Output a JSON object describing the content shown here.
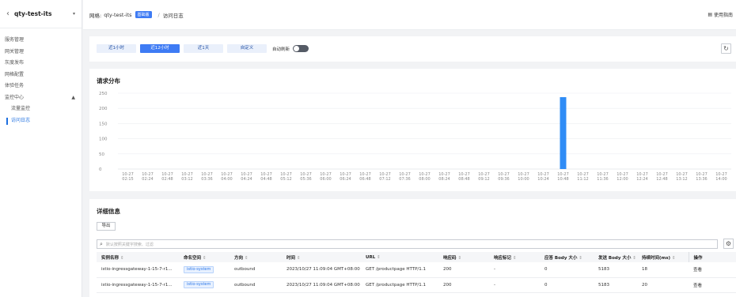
{
  "sidebar": {
    "title": "qty-test-its",
    "items": [
      {
        "label": "服务管理"
      },
      {
        "label": "网关管理"
      },
      {
        "label": "灰度发布"
      },
      {
        "label": "网格配置"
      },
      {
        "label": "体验任务"
      }
    ],
    "group": {
      "label": "监控中心",
      "sub": [
        {
          "label": "流量监控"
        },
        {
          "label": "访问日志"
        }
      ]
    }
  },
  "topbar": {
    "mesh_prefix": "网格:",
    "mesh_name": "qty-test-its",
    "edition": "基础版",
    "separator": "/",
    "page": "访问日志",
    "guide": "使用指南"
  },
  "range": {
    "tabs": [
      "近1小时",
      "近12小时",
      "近1天",
      "自定义"
    ],
    "active_index": 1,
    "auto_refresh_label": "自动刷新",
    "auto_refresh_on": false
  },
  "chart": {
    "title": "请求分布",
    "color": "#2f8cf6"
  },
  "chart_data": {
    "type": "bar",
    "title": "请求分布",
    "ylim": [
      0,
      250
    ],
    "yticks": [
      0,
      50,
      100,
      150,
      200,
      250
    ],
    "categories": [
      "10-27 02:15",
      "10-27 02:24",
      "10-27 02:48",
      "10-27 03:12",
      "10-27 03:36",
      "10-27 04:00",
      "10-27 04:24",
      "10-27 04:48",
      "10-27 05:12",
      "10-27 05:36",
      "10-27 06:00",
      "10-27 06:24",
      "10-27 06:48",
      "10-27 07:12",
      "10-27 07:36",
      "10-27 08:00",
      "10-27 08:24",
      "10-27 08:48",
      "10-27 09:12",
      "10-27 09:36",
      "10-27 10:00",
      "10-27 10:24",
      "10-27 10:48",
      "10-27 11:12",
      "10-27 11:36",
      "10-27 12:00",
      "10-27 12:24",
      "10-27 12:48",
      "10-27 13:12",
      "10-27 13:36",
      "10-27 14:00"
    ],
    "values": [
      0,
      0,
      0,
      0,
      0,
      0,
      0,
      0,
      0,
      0,
      0,
      0,
      0,
      0,
      0,
      0,
      0,
      0,
      0,
      0,
      0,
      0,
      237,
      0,
      0,
      0,
      0,
      0,
      0,
      0,
      0
    ],
    "grid": true
  },
  "detail": {
    "title": "详细信息",
    "export_label": "导出",
    "search_placeholder": "默认按照关键字搜索、过滤",
    "columns": [
      "实例名称",
      "命名空间",
      "方向",
      "时间",
      "URL",
      "响应码",
      "响应标记",
      "应答 Body 大小",
      "发送 Body 大小",
      "持续时间(ms)",
      "操作"
    ],
    "rows": [
      {
        "instance": "istio-ingressgateway-1-15-7-r1...",
        "namespace": "istio-system",
        "direction": "outbound",
        "time": "2023/10/27 11:09:04 GMT+08:00",
        "url": "GET /productpage HTTP/1.1",
        "code": "200",
        "flags": "-",
        "resp_body": "0",
        "send_body": "5183",
        "duration": "18",
        "action": "查看"
      },
      {
        "instance": "istio-ingressgateway-1-15-7-r1...",
        "namespace": "istio-system",
        "direction": "outbound",
        "time": "2023/10/27 11:09:04 GMT+08:00",
        "url": "GET /productpage HTTP/1.1",
        "code": "200",
        "flags": "-",
        "resp_body": "0",
        "send_body": "5183",
        "duration": "20",
        "action": "查看"
      }
    ]
  }
}
